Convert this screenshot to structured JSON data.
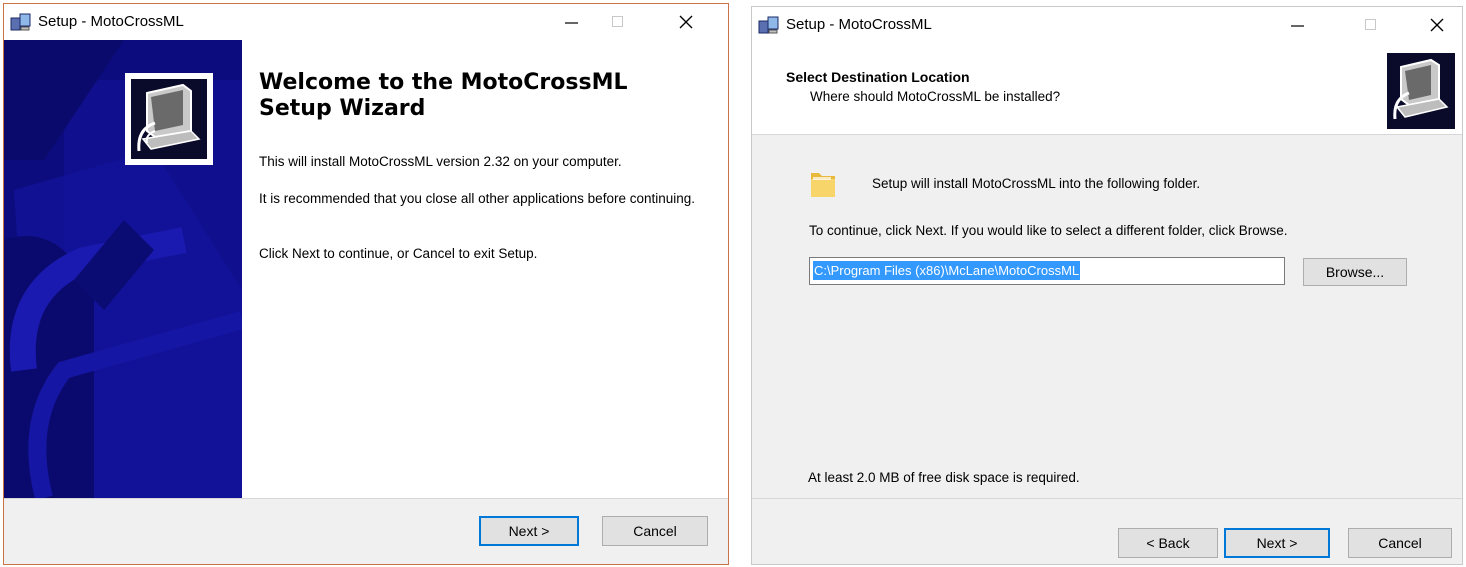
{
  "welcome_window": {
    "title": "Setup - MotoCrossML",
    "heading": "Welcome to the MotoCrossML Setup Wizard",
    "paragraph_1": "This will install MotoCrossML version 2.32 on your computer.",
    "paragraph_2": "It is recommended that you close all other applications before continuing.",
    "paragraph_3": "Click Next to continue, or Cancel to exit Setup.",
    "next_label": "Next >",
    "cancel_label": "Cancel"
  },
  "destination_window": {
    "title": "Setup - MotoCrossML",
    "header_title": "Select Destination Location",
    "header_subtitle": "Where should MotoCrossML be installed?",
    "info_text": "Setup will install MotoCrossML into the following folder.",
    "continue_text": "To continue, click Next. If you would like to select a different folder, click Browse.",
    "install_path": "C:\\Program Files (x86)\\McLane\\MotoCrossML",
    "browse_label": "Browse...",
    "disk_space_text": "At least 2.0 MB of free disk space is required.",
    "back_label": "< Back",
    "next_label": "Next >",
    "cancel_label": "Cancel"
  },
  "icons": {
    "app": "setup-app-icon",
    "minimize": "minimize-icon",
    "maximize": "maximize-icon",
    "close": "close-icon",
    "wizard_logo": "computer-install-icon",
    "folder": "folder-icon"
  },
  "colors": {
    "side_panel": "#0c0c7e",
    "default_button_border": "#0078d7",
    "selection": "#3399ff",
    "window_bg": "#f0f0f0"
  }
}
